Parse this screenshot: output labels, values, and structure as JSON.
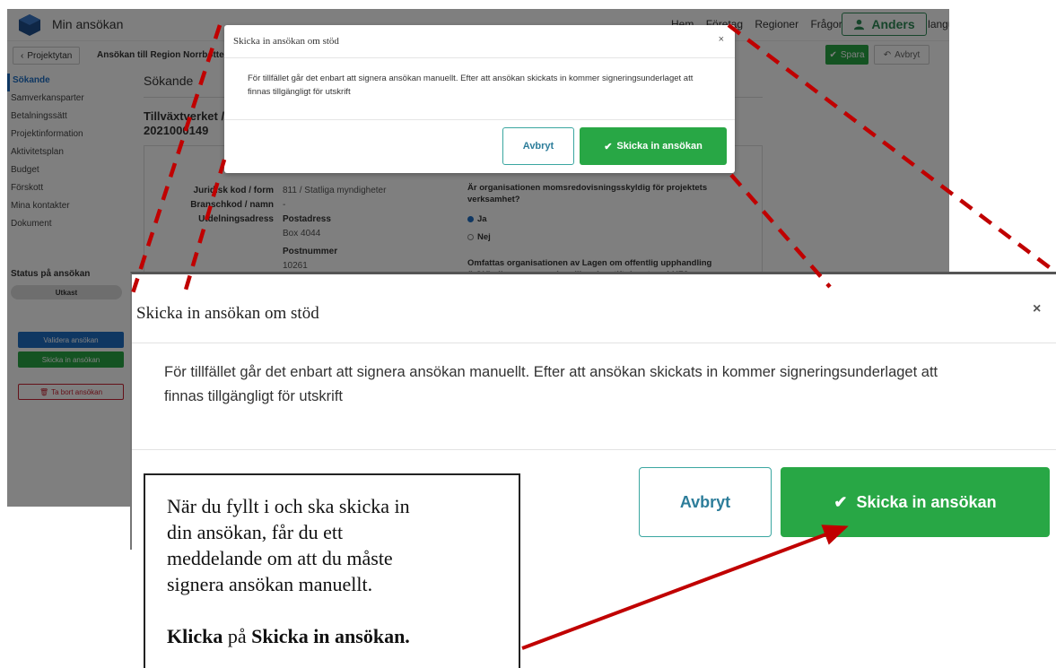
{
  "background": {
    "app_title": "Min ansökan",
    "nav_links": [
      "Hem",
      "Företag",
      "Regioner",
      "Frågor och svar",
      "Other language"
    ],
    "user_name": "Anders",
    "back_label": "Projektytan",
    "crumb_title": "Ansökan till Region Norrbotten",
    "save_label": "Spara",
    "cancel_label": "Avbryt",
    "sidebar": {
      "items": [
        "Sökande",
        "Samverkansparter",
        "Betalningssätt",
        "Projektinformation",
        "Aktivitetsplan",
        "Budget",
        "Förskott",
        "Mina kontakter",
        "Dokument"
      ],
      "active_index": 0,
      "status_label": "Status på ansökan",
      "status_value": "Utkast",
      "validate_label": "Validera ansökan",
      "submit_label": "Skicka in ansökan",
      "delete_label": "Ta bort ansökan"
    },
    "section_heading": "Sökande",
    "org_name": "Tillväxtverket /",
    "org_number": "2021000149",
    "form": {
      "legal_code_label": "Juridisk kod / form",
      "legal_code_value": "811 / Statliga myndigheter",
      "industry_label": "Branschkod / namn",
      "industry_value": "-",
      "address_label": "Utdelningsadress",
      "postal_address_label": "Postadress",
      "postal_address_value": "Box 4044",
      "postcode_label": "Postnummer",
      "postcode_value": "10261",
      "vat_question": "Är organisationen momsredovisningsskyldig för projektets verksamhet?",
      "vat_yes": "Ja",
      "vat_no": "Nej",
      "lou_question": "Omfattas organisationen av Lagen om offentlig upphandling (LOU) eller annan upphandlingslagstiftning, t.ex. LUF?"
    },
    "dialog": {
      "title": "Skicka in ansökan om stöd",
      "body": "För tillfället går det enbart att signera ansökan manuellt. Efter att ansökan skickats in kommer signeringsunderlaget att finnas tillgängligt för utskrift",
      "cancel": "Avbryt",
      "submit": "Skicka in ansökan"
    }
  },
  "zoomed_dialog": {
    "title": "Skicka in ansökan om stöd",
    "close": "×",
    "body": "För tillfället går det enbart att signera ansökan manuellt. Efter att ansökan skickats in kommer signeringsunderlaget att finnas tillgängligt för utskrift",
    "cancel": "Avbryt",
    "submit": "Skicka in ansökan"
  },
  "callout": {
    "line1": "När du fyllt i och ska skicka in",
    "line2": "din ansökan, får du ett",
    "line3": "meddelande om att du måste",
    "line4": "signera ansökan manuellt.",
    "bold1": "Klicka",
    "mid": " på ",
    "bold2": "Skicka in ansökan."
  },
  "colors": {
    "primary_green": "#28a745",
    "outline_teal": "#3aa6a0",
    "link_blue": "#1f6fc5",
    "annotation_red": "#c00000"
  }
}
